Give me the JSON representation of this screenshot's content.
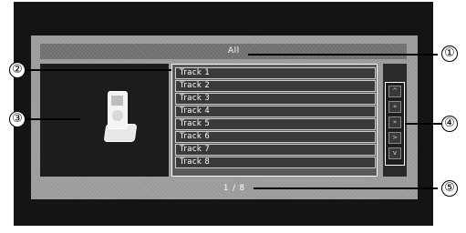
{
  "screen": {
    "header_title": "All",
    "page_indicator": "1 / 8"
  },
  "track_list": [
    {
      "label": "Track 1"
    },
    {
      "label": "Track 2"
    },
    {
      "label": "Track 3"
    },
    {
      "label": "Track 4"
    },
    {
      "label": "Track 5"
    },
    {
      "label": "Track 6"
    },
    {
      "label": "Track 7"
    },
    {
      "label": "Track 8"
    }
  ],
  "side_controls": [
    {
      "icon": "scroll-up-icon",
      "glyph": "^"
    },
    {
      "icon": "page-up-icon",
      "glyph": "«"
    },
    {
      "icon": "page-down-icon",
      "glyph": "»"
    },
    {
      "icon": "next-icon",
      "glyph": ">"
    },
    {
      "icon": "scroll-down-icon",
      "glyph": "v"
    }
  ],
  "callouts": [
    "①",
    "②",
    "③",
    "④",
    "⑤"
  ],
  "colors": {
    "screen_bg": "#141414",
    "panel_bg": "#9a9a9a",
    "row_bg": "#3a3a3a",
    "text": "#ffffff"
  }
}
